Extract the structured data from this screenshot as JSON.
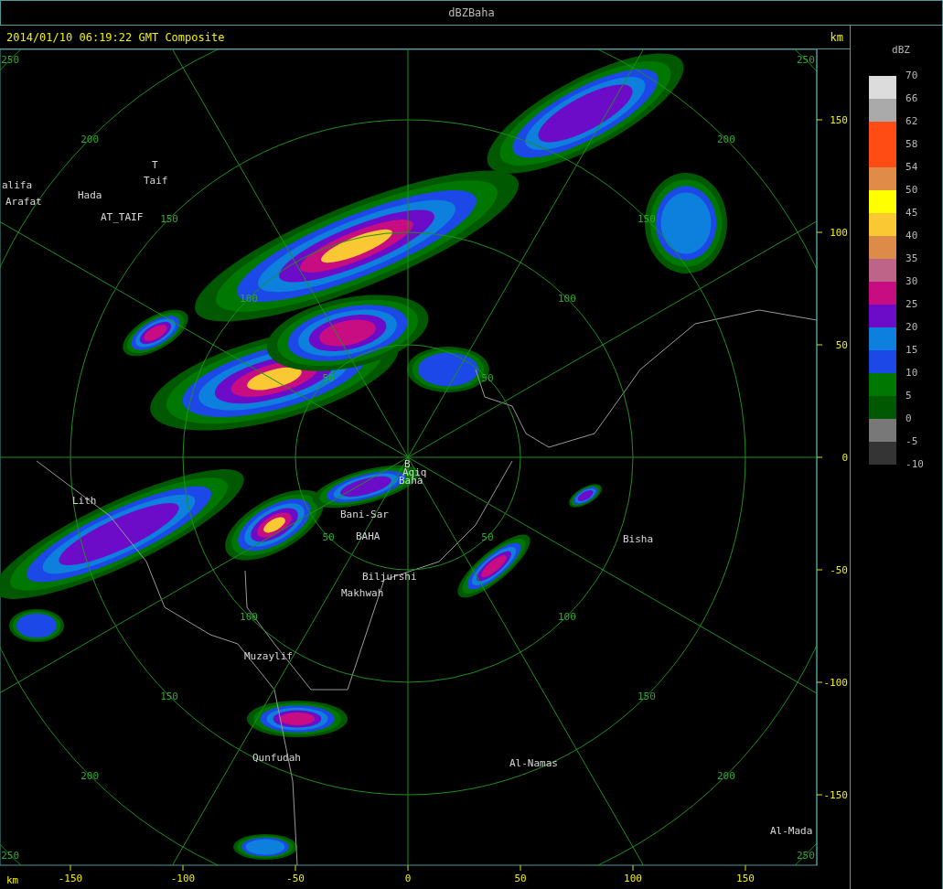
{
  "window": {
    "title": "dBZBaha"
  },
  "header": {
    "timestamp": "2014/01/10 06:19:22 GMT Composite"
  },
  "map": {
    "ring_labels": [
      {
        "labels": [
          "50",
          "50",
          "50",
          "50"
        ]
      },
      {
        "labels": [
          "100",
          "100",
          "100",
          "100"
        ]
      },
      {
        "labels": [
          "150",
          "150",
          "150",
          "150"
        ]
      },
      {
        "labels": [
          "200",
          "200",
          "200",
          "200"
        ]
      },
      {
        "labels": [
          "250",
          "250",
          "250",
          "250"
        ]
      }
    ],
    "places": [
      "alifa",
      "Arafat",
      "Hada",
      "T",
      "Taif",
      "AT_TAIF",
      "Lith",
      "B",
      "Aqiq",
      "Baha",
      "Bani-Sar",
      "BAHA",
      "Biljurshi",
      "Makhwah",
      "Bisha",
      "Muzaylif",
      "Qunfudah",
      "Al-Namas",
      "Al-Mada"
    ]
  },
  "y_axis": {
    "unit": "km",
    "ticks": [
      "150",
      "100",
      "50",
      "0",
      "-50",
      "-100",
      "-150"
    ]
  },
  "x_axis": {
    "unit": "km",
    "ticks": [
      "-150",
      "-100",
      "-50",
      "0",
      "50",
      "100",
      "150"
    ]
  },
  "legend": {
    "title": "dBZ",
    "bands": [
      {
        "label": "70",
        "color": "#dcdcdc"
      },
      {
        "label": "66",
        "color": "#aaaaaa"
      },
      {
        "label": "62",
        "color": "#ff4c14"
      },
      {
        "label": "58",
        "color": "#ff4c14"
      },
      {
        "label": "54",
        "color": "#e08c48"
      },
      {
        "label": "50",
        "color": "#ffff00"
      },
      {
        "label": "45",
        "color": "#fac832"
      },
      {
        "label": "40",
        "color": "#dc8c48"
      },
      {
        "label": "35",
        "color": "#be6488"
      },
      {
        "label": "30",
        "color": "#c80c82"
      },
      {
        "label": "25",
        "color": "#6c0cc8"
      },
      {
        "label": "20",
        "color": "#0c80dc"
      },
      {
        "label": "15",
        "color": "#1c48e8"
      },
      {
        "label": "10",
        "color": "#007800"
      },
      {
        "label": "5",
        "color": "#005800"
      },
      {
        "label": "0",
        "color": "#787878"
      },
      {
        "label": "-5",
        "color": "#343434"
      }
    ],
    "bottom_label": "-10"
  }
}
